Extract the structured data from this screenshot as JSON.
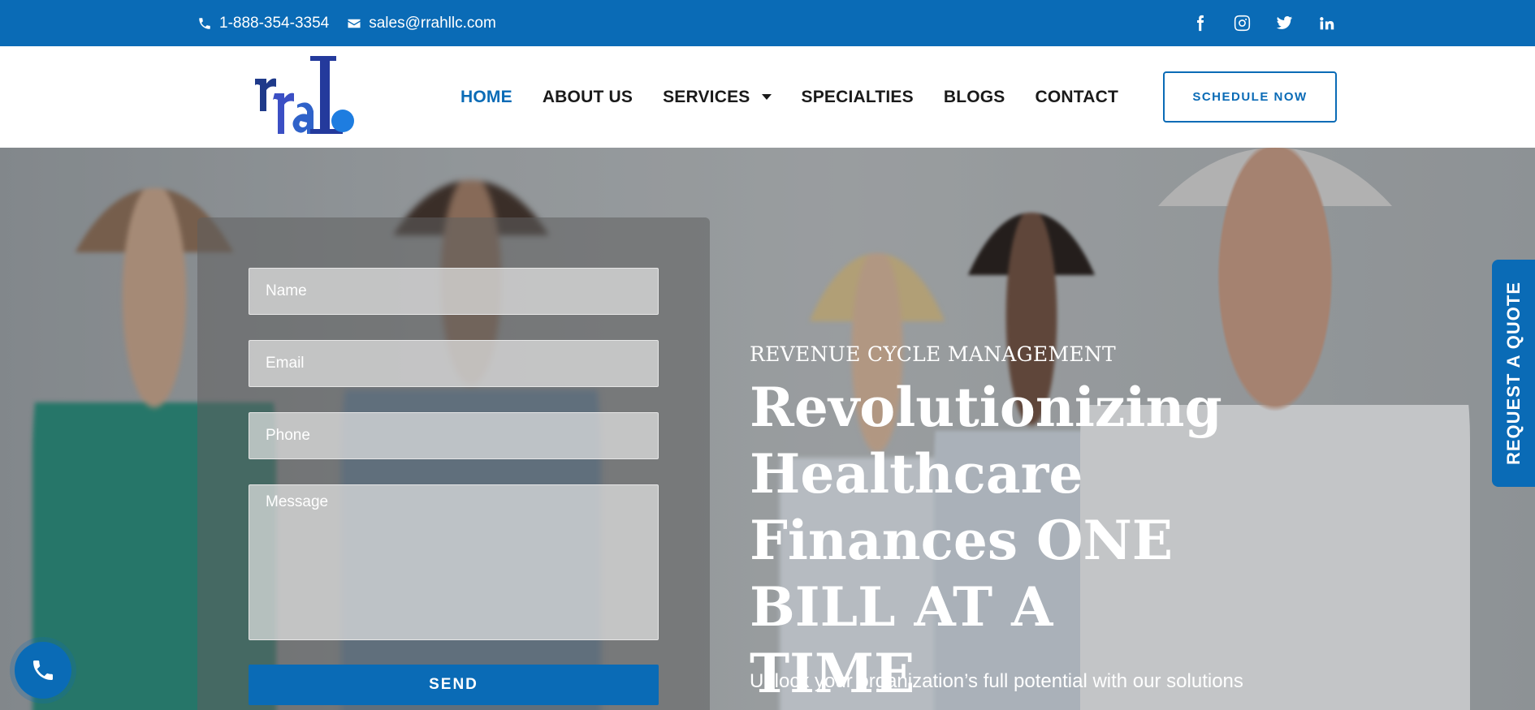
{
  "topbar": {
    "phone": "1-888-354-3354",
    "email": "sales@rrahllc.com",
    "social": [
      "facebook-icon",
      "instagram-icon",
      "twitter-icon",
      "linkedin-icon"
    ]
  },
  "nav": {
    "items": [
      {
        "label": "HOME",
        "active": true
      },
      {
        "label": "ABOUT US"
      },
      {
        "label": "SERVICES",
        "dropdown": true
      },
      {
        "label": "SPECIALTIES"
      },
      {
        "label": "BLOGS"
      },
      {
        "label": "CONTACT"
      }
    ],
    "cta": "SCHEDULE NOW"
  },
  "form": {
    "name_placeholder": "Name",
    "email_placeholder": "Email",
    "phone_placeholder": "Phone",
    "message_placeholder": "Message",
    "send_label": "SEND"
  },
  "hero": {
    "kicker": "REVENUE CYCLE MANAGEMENT",
    "title": "Revolutionizing Healthcare Finances ONE BILL AT A TIME",
    "subtitle": "Unlock your organization’s full potential with our solutions"
  },
  "side_tab": "REQUEST A QUOTE",
  "colors": {
    "brand": "#0a6bb6"
  }
}
